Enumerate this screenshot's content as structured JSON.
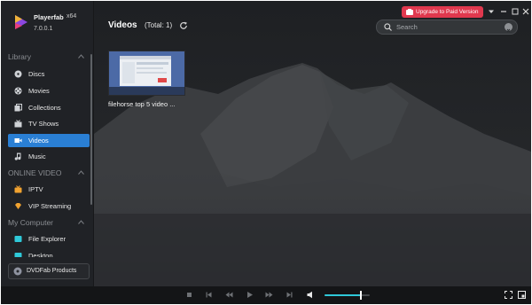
{
  "app": {
    "name": "Playerfab",
    "arch": "x64",
    "version": "7.0.0.1",
    "brand_colors": {
      "accent": "#2a7fd4",
      "upgrade": "#e0384e",
      "volume": "#2fc9d9"
    }
  },
  "header": {
    "title": "Videos",
    "total_label": "(Total: 1)",
    "upgrade_label": "Upgrade to Paid Version",
    "search_placeholder": "Search",
    "search_value": ""
  },
  "sidebar": {
    "sections": [
      {
        "label": "Library",
        "collapsed": false,
        "items": [
          {
            "label": "Discs",
            "icon": "disc-icon",
            "active": false
          },
          {
            "label": "Movies",
            "icon": "film-reel-icon",
            "active": false
          },
          {
            "label": "Collections",
            "icon": "collections-icon",
            "active": false
          },
          {
            "label": "TV Shows",
            "icon": "tv-icon",
            "active": false
          },
          {
            "label": "Videos",
            "icon": "video-icon",
            "active": true
          },
          {
            "label": "Music",
            "icon": "music-note-icon",
            "active": false
          }
        ]
      },
      {
        "label": "ONLINE VIDEO",
        "collapsed": false,
        "items": [
          {
            "label": "IPTV",
            "icon": "iptv-icon",
            "active": false
          },
          {
            "label": "VIP Streaming",
            "icon": "vip-diamond-icon",
            "active": false
          }
        ]
      },
      {
        "label": "My Computer",
        "collapsed": false,
        "items": [
          {
            "label": "File Explorer",
            "icon": "folder-icon",
            "active": false
          },
          {
            "label": "Desktop",
            "icon": "desktop-icon",
            "active": false
          }
        ]
      }
    ],
    "footer_button": "DVDFab Products"
  },
  "videos": [
    {
      "title": "filehorse top 5 video ..."
    }
  ],
  "player": {
    "volume_level": 0.8
  }
}
